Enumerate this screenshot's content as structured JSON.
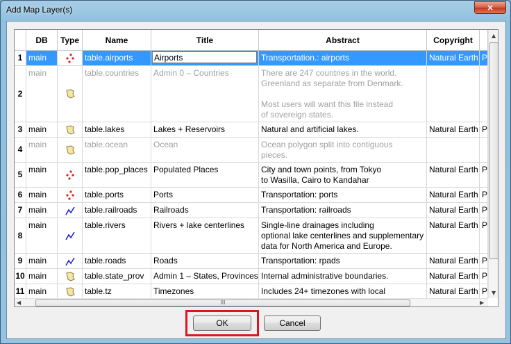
{
  "window": {
    "title": "Add Map Layer(s)",
    "close_symbol": "×"
  },
  "table": {
    "columns": [
      "",
      "DB",
      "Type",
      "Name",
      "Title",
      "Abstract",
      "Copyright",
      ""
    ],
    "rows": [
      {
        "num": "1",
        "db": "main",
        "type_icon": "points-icon",
        "name": "table.airports",
        "title": "Airports",
        "abstract": "Transportation.: airports",
        "copyright": "Natural Earth",
        "extra": "P",
        "selected": true,
        "disabled": false
      },
      {
        "num": "2",
        "db": "main",
        "type_icon": "polygon-icon",
        "name": "table.countries",
        "title": "Admin 0 – Countries",
        "abstract": "There are 247 countries in the world.\nGreenland as separate from Denmark.\n\nMost users will want this file instead\nof sovereign states.",
        "copyright": "",
        "extra": "",
        "selected": false,
        "disabled": true
      },
      {
        "num": "3",
        "db": "main",
        "type_icon": "polygon-icon",
        "name": "table.lakes",
        "title": "Lakes + Reservoirs",
        "abstract": "Natural and artificial lakes.",
        "copyright": "Natural Earth",
        "extra": "P",
        "selected": false,
        "disabled": false
      },
      {
        "num": "4",
        "db": "main",
        "type_icon": "polygon-icon",
        "name": "table.ocean",
        "title": "Ocean",
        "abstract": "Ocean polygon split into contiguous\npieces.",
        "copyright": "",
        "extra": "",
        "selected": false,
        "disabled": true
      },
      {
        "num": "5",
        "db": "main",
        "type_icon": "points-icon",
        "name": "table.pop_places",
        "title": "Populated Places",
        "abstract": "City and town points, from Tokyo\nto Wasilla, Cairo to Kandahar",
        "copyright": "Natural Earth",
        "extra": "P",
        "selected": false,
        "disabled": false
      },
      {
        "num": "6",
        "db": "main",
        "type_icon": "points-icon",
        "name": "table.ports",
        "title": "Ports",
        "abstract": "Transportation: ports",
        "copyright": "Natural Earth",
        "extra": "P",
        "selected": false,
        "disabled": false
      },
      {
        "num": "7",
        "db": "main",
        "type_icon": "line-icon",
        "name": "table.railroads",
        "title": "Railroads",
        "abstract": "Transportation: railroads",
        "copyright": "Natural Earth",
        "extra": "P",
        "selected": false,
        "disabled": false
      },
      {
        "num": "8",
        "db": "main",
        "type_icon": "line-icon",
        "name": "table.rivers",
        "title": "Rivers + lake centerlines",
        "abstract": "Single-line drainages including\noptional lake centerlines and supplementary\ndata for North America and Europe.",
        "copyright": "Natural Earth",
        "extra": "P",
        "selected": false,
        "disabled": false
      },
      {
        "num": "9",
        "db": "main",
        "type_icon": "line-icon",
        "name": "table.roads",
        "title": "Roads",
        "abstract": "Transportation: rpads",
        "copyright": "Natural Earth",
        "extra": "P",
        "selected": false,
        "disabled": false
      },
      {
        "num": "10",
        "db": "main",
        "type_icon": "polygon-icon",
        "name": "table.state_prov",
        "title": "Admin 1 – States, Provinces",
        "abstract": "Internal administrative boundaries.",
        "copyright": "Natural Earth",
        "extra": "P",
        "selected": false,
        "disabled": false
      },
      {
        "num": "11",
        "db": "main",
        "type_icon": "polygon-icon",
        "name": "table.tz",
        "title": "Timezones",
        "abstract": "Includes 24+ timezones with local",
        "copyright": "Natural Earth",
        "extra": "P",
        "selected": false,
        "disabled": false
      }
    ],
    "hscroll_grip": "III"
  },
  "buttons": {
    "ok": "OK",
    "cancel": "Cancel"
  },
  "colors": {
    "selection": "#3399ff",
    "highlight": "#e0141e"
  }
}
